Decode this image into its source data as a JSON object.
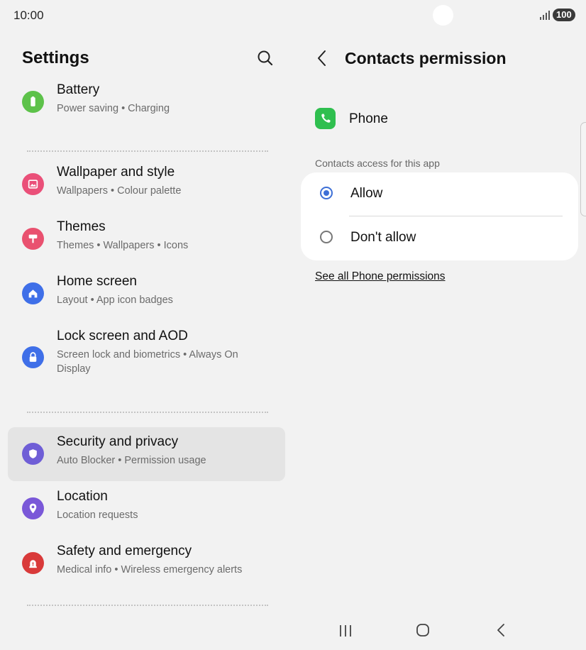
{
  "status_bar": {
    "time": "10:00",
    "battery": "100"
  },
  "left": {
    "title": "Settings",
    "items": [
      {
        "title": "Battery",
        "subtitle": "Power saving  •  Charging",
        "color": "#5dc24a",
        "icon": "battery-icon"
      },
      {
        "title": "Wallpaper and style",
        "subtitle": "Wallpapers  •  Colour palette",
        "color": "#ea5079",
        "icon": "wallpaper-icon"
      },
      {
        "title": "Themes",
        "subtitle": "Themes  •  Wallpapers  •  Icons",
        "color": "#e9516f",
        "icon": "paint-roller-icon"
      },
      {
        "title": "Home screen",
        "subtitle": "Layout  •  App icon badges",
        "color": "#3f6fe8",
        "icon": "home-icon"
      },
      {
        "title": "Lock screen and AOD",
        "subtitle": "Screen lock and biometrics  •  Always On Display",
        "color": "#3f6fe8",
        "icon": "lock-icon"
      },
      {
        "title": "Security and privacy",
        "subtitle": "Auto Blocker  •  Permission usage",
        "color": "#6f5ed6",
        "icon": "shield-icon"
      },
      {
        "title": "Location",
        "subtitle": "Location requests",
        "color": "#7a58d8",
        "icon": "location-pin-icon"
      },
      {
        "title": "Safety and emergency",
        "subtitle": "Medical info  •  Wireless emergency alerts",
        "color": "#d93a3a",
        "icon": "emergency-icon"
      }
    ]
  },
  "right": {
    "title": "Contacts permission",
    "app_name": "Phone",
    "section_label": "Contacts access for this app",
    "options": [
      {
        "label": "Allow",
        "selected": true
      },
      {
        "label": "Don't allow",
        "selected": false
      }
    ],
    "link": "See all Phone permissions"
  },
  "colors": {
    "accent": "#3d6fd6",
    "background": "#f2f2f2",
    "selected_row": "#e4e4e4"
  }
}
